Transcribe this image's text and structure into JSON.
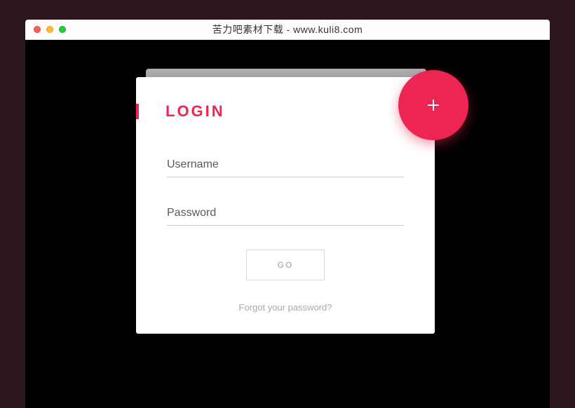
{
  "window": {
    "title": "苦力吧素材下载 - www.kuli8.com"
  },
  "card": {
    "title": "LOGIN",
    "fab_icon": "plus-icon"
  },
  "form": {
    "username": {
      "placeholder": "Username",
      "value": ""
    },
    "password": {
      "placeholder": "Password",
      "value": ""
    },
    "submit_label": "GO",
    "forgot_label": "Forgot your password?"
  },
  "colors": {
    "accent": "#ed2553"
  }
}
